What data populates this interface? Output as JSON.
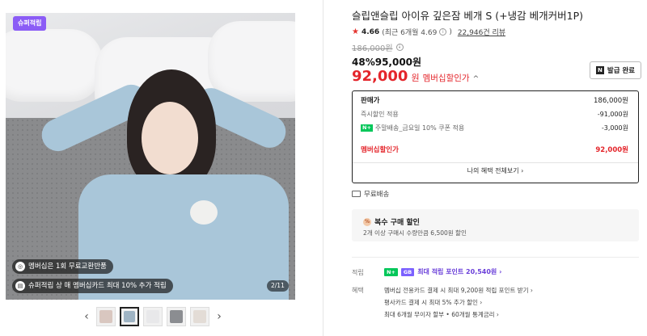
{
  "gallery": {
    "super_badge": "슈퍼적립",
    "promo1": "멤버십은 1회 무료교환반품",
    "promo2": "슈퍼적립 상 매 멤버십카드 최대 10% 추가 적립",
    "counter": "2/11",
    "prev": "‹",
    "next": "›",
    "thumbnail_count": 5,
    "active_thumbnail": 2
  },
  "product": {
    "title": "슬립앤슬립 아이유 깊은잠 베개 S (+냉감 베개커버1P)",
    "rating": "4.66",
    "rating_detail": "(최근 6개월 4.69",
    "rating_detail_close": ")",
    "review_count": "22,946건 리뷰",
    "original_price": "186,000원",
    "discount_line": "48%95,000원",
    "member_price": "92,000",
    "member_won": "원",
    "member_label": "멤버십할인가",
    "member_caret": "^",
    "coupon_button": "발급 완료",
    "coupon_icon": "N"
  },
  "price_box": {
    "sale_label": "판매가",
    "sale_value": "186,000원",
    "instant_label": "즉시할인 적용",
    "instant_value": "-91,000원",
    "np_icon": "N+",
    "coupon_label": "주말배송_금요일 10% 쿠폰 적용",
    "coupon_value": "-3,000원",
    "total_label": "멤버십할인가",
    "total_value": "92,000원",
    "more": "나의 혜택 전체보기 ›"
  },
  "shipping": {
    "label": "무료배송"
  },
  "multi": {
    "title": "복수 구매 할인",
    "desc": "2개 이상 구매시 수량만큼 6,500원 할인"
  },
  "benefits": {
    "point_label": "적립",
    "point_badge_n": "N+",
    "point_badge_m": "GB",
    "point_text": "최대 적립 포인트 20,540원 ›",
    "benefit_label": "혜택",
    "line1": "멤버십 전용카드 결제 시 최대 9,200원 적립 포인트 받기 ›",
    "line2": "평사카드 결제 시 최대 5% 추가 할인 ›",
    "line3": "최대 6개월 무이자 할부 • 60개월 통계금리 ›"
  }
}
